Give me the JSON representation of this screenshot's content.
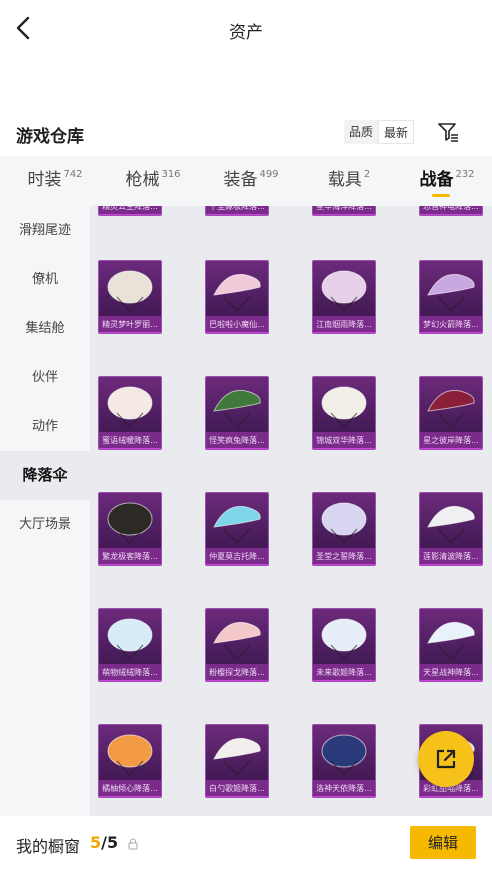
{
  "header": {
    "title": "资产"
  },
  "warehouse": {
    "title": "游戏仓库",
    "sort_options": [
      "品质",
      "最新"
    ],
    "selected_sort": "最新"
  },
  "tabs": [
    {
      "label": "时装",
      "count": "742",
      "active": false
    },
    {
      "label": "枪械",
      "count": "316",
      "active": false
    },
    {
      "label": "装备",
      "count": "499",
      "active": false
    },
    {
      "label": "载具",
      "count": "2",
      "active": false
    },
    {
      "label": "战备",
      "count": "232",
      "active": true
    }
  ],
  "sidebar": {
    "items": [
      {
        "label": "滑翔尾迹",
        "active": false
      },
      {
        "label": "僚机",
        "active": false
      },
      {
        "label": "集结舱",
        "active": false
      },
      {
        "label": "伙伴",
        "active": false
      },
      {
        "label": "动作",
        "active": false
      },
      {
        "label": "降落伞",
        "active": true
      },
      {
        "label": "大厅场景",
        "active": false
      }
    ]
  },
  "items": [
    {
      "name": "精灵梦叶罗丽...",
      "color": "#e8e2d8"
    },
    {
      "name": "巴啦啦小魔仙...",
      "color": "#f2c9d8"
    },
    {
      "name": "江南烟雨降落...",
      "color": "#e6d0ea"
    },
    {
      "name": "梦幻火箭降落...",
      "color": "#c9a7e0"
    },
    {
      "name": "蜜语绒暖降落...",
      "color": "#f4e9e4"
    },
    {
      "name": "怪笑疯兔降落...",
      "color": "#3f7a3a"
    },
    {
      "name": "锦城双华降落...",
      "color": "#f2efe6"
    },
    {
      "name": "星之彼岸降落...",
      "color": "#8a1f3a"
    },
    {
      "name": "繁龙极客降落...",
      "color": "#2d2a26"
    },
    {
      "name": "仲夏莫吉托降...",
      "color": "#7fd6ea"
    },
    {
      "name": "圣堂之誓降落...",
      "color": "#d8d6f0"
    },
    {
      "name": "莲影清波降落...",
      "color": "#f0f0f2"
    },
    {
      "name": "萌物绒绒降落...",
      "color": "#d7ecf7"
    },
    {
      "name": "粉樱探戈降落...",
      "color": "#f4c7c9"
    },
    {
      "name": "未来歌姬降落...",
      "color": "#e8eef8"
    },
    {
      "name": "天星战神降落...",
      "color": "#e9f2fb"
    },
    {
      "name": "橘柚倾心降落...",
      "color": "#f39a45"
    },
    {
      "name": "白勺歌姬降落...",
      "color": "#f2eeee"
    },
    {
      "name": "洛神天依降落...",
      "color": "#2a3a7a"
    },
    {
      "name": "彩虹甜喵降落...",
      "color": "#f6f1f3"
    }
  ],
  "partial_items": [
    {
      "name": "精灵公主降落..."
    },
    {
      "name": "千里嫁妆降落..."
    },
    {
      "name": "星华海洋降落..."
    },
    {
      "name": "恐音神电降落..."
    }
  ],
  "showcase": {
    "label": "我的橱窗",
    "current": "5",
    "separator": "/",
    "max": "5",
    "edit_label": "编辑"
  },
  "colors": {
    "accent": "#f6b900",
    "card_purple": "#6d2a7c"
  }
}
